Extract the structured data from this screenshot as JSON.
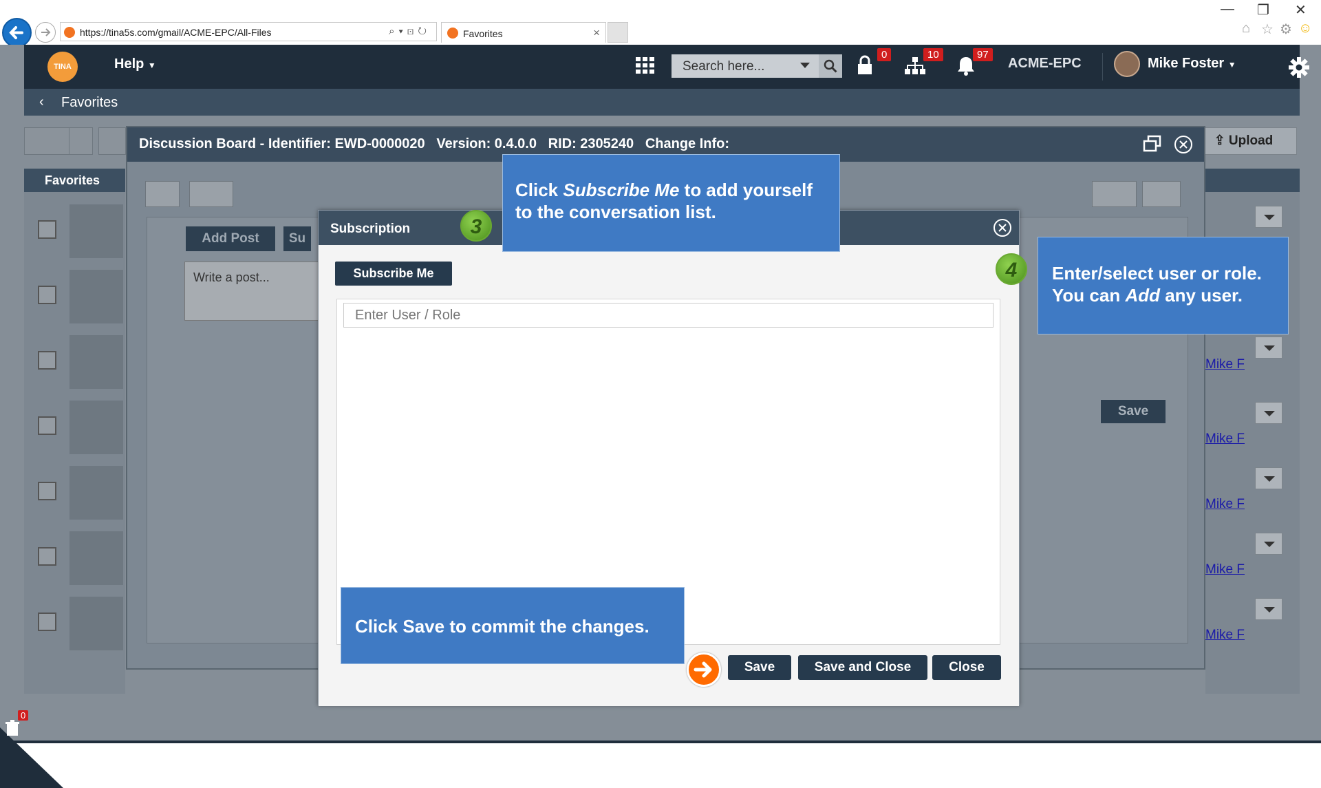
{
  "browser": {
    "url": "https://tina5s.com/gmail/ACME-EPC/All-Files",
    "tab_title": "Favorites",
    "tab_close": "×"
  },
  "topnav": {
    "logo_text": "TINA",
    "help_label": "Help",
    "search_placeholder": "Search here...",
    "lock_count": "0",
    "org_count": "10",
    "bell_count": "97",
    "tenant": "ACME-EPC",
    "user_name": "Mike Foster"
  },
  "subnav": {
    "title": "Favorites"
  },
  "toolbar": {
    "upload_label": "Upload"
  },
  "favorites_panel": {
    "title": "Favorites"
  },
  "right_list": {
    "author_links": [
      "Mike F",
      "Mike F",
      "Mike F",
      "Mike F",
      "Mike F"
    ]
  },
  "discussion": {
    "title": "Discussion Board - Identifier: EWD-0000020   Version: 0.4.0.0   RID: 2305240   Change Info:",
    "add_post_label": "Add Post",
    "subscribe_tab_label": "Su",
    "write_placeholder": "Write a post...",
    "save_label": "Save"
  },
  "subscription": {
    "title": "Subscription",
    "subscribe_me_label": "Subscribe Me",
    "user_role_placeholder": "Enter User / Role",
    "save_label": "Save",
    "save_close_label": "Save and Close",
    "close_label": "Close"
  },
  "callouts": {
    "subscribe_pre": "Click ",
    "subscribe_em": "Subscribe Me",
    "subscribe_post": " to add yourself to the conversation list.",
    "user_line1": "Enter/select user or role.",
    "user_line2_pre": "You can ",
    "user_line2_em": "Add",
    "user_line2_post": " any user.",
    "save_text": "Click Save to commit the changes.",
    "step3": "3",
    "step4": "4"
  },
  "trash": {
    "count": "0"
  },
  "colors": {
    "accent": "#3f7ac4",
    "nav": "#1f2d3b",
    "button": "#263a4d",
    "badge": "#d01e1e",
    "step": "#6aa932",
    "arrow": "#ff6a00"
  }
}
